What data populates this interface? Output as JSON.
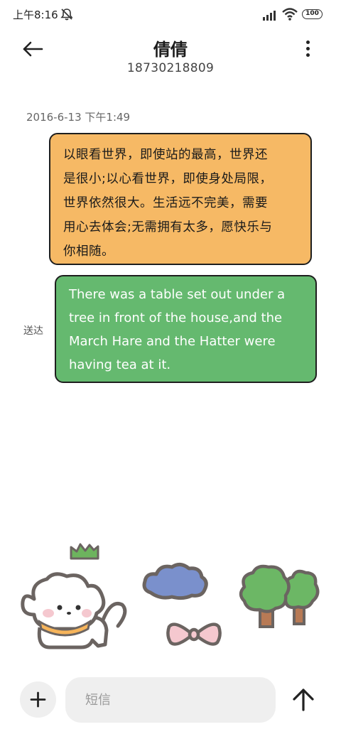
{
  "status_bar": {
    "time": "上午8:16",
    "battery": "100",
    "icons": [
      "mute-icon",
      "signal-icon",
      "wifi-icon",
      "battery-icon"
    ]
  },
  "header": {
    "back_icon": "arrow-left-icon",
    "contact_name": "倩倩",
    "contact_number": "18730218809",
    "more_icon": "more-vertical-icon"
  },
  "messages": [
    {
      "direction": "received",
      "timestamp": "2016-6-13 下午1:49",
      "lines": [
        "以眼看世界，即使站的最高，世界还",
        "是很小;以心看世界，即使身处局限，",
        "世界依然很大。生活远不完美，需要",
        "用心去体会;无需拥有太多，愿快乐与",
        "你相随。"
      ],
      "color": "#f6b965"
    },
    {
      "direction": "sent",
      "status": "送达",
      "lines": [
        "There was a table set out under a",
        "tree in front of the house,and the",
        "March Hare and the Hatter were",
        "having tea at it."
      ],
      "color": "#65b96f"
    }
  ],
  "composer": {
    "add_icon": "plus-icon",
    "placeholder": "短信",
    "value": "",
    "send_icon": "arrow-up-icon"
  },
  "decorations": [
    "puppy-illustration",
    "grass-illustration",
    "cloud-illustration",
    "bow-illustration",
    "trees-illustration"
  ],
  "colors": {
    "received_bubble": "#f6b965",
    "sent_bubble": "#65b96f",
    "input_background": "#efefef"
  }
}
